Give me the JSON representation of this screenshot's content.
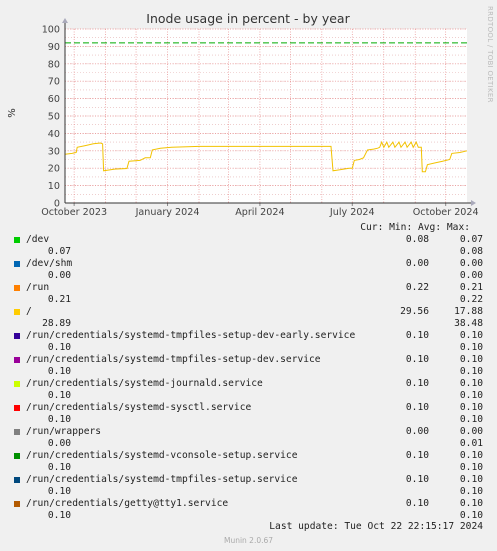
{
  "chart_data": {
    "type": "line",
    "title": "Inode usage in percent - by year",
    "ylabel": "%",
    "ylim": [
      0,
      100
    ],
    "yticks": [
      0,
      10,
      20,
      30,
      40,
      50,
      60,
      70,
      80,
      90,
      100
    ],
    "xticks": [
      "October 2023",
      "January 2024",
      "April 2024",
      "July 2024",
      "October 2024"
    ],
    "xrange": [
      "2023-09-22",
      "2024-10-22"
    ],
    "grid": true,
    "warning_level": 92,
    "series": [
      {
        "name": "/",
        "color": "#f2c200",
        "points": [
          [
            "2023-09-22",
            28
          ],
          [
            "2023-09-29",
            28.5
          ],
          [
            "2023-10-03",
            29
          ],
          [
            "2023-10-04",
            32
          ],
          [
            "2023-10-12",
            33
          ],
          [
            "2023-10-20",
            34
          ],
          [
            "2023-10-27",
            34.5
          ],
          [
            "2023-10-29",
            34
          ],
          [
            "2023-10-30",
            18.5
          ],
          [
            "2023-11-10",
            19.5
          ],
          [
            "2023-11-22",
            19.8
          ],
          [
            "2023-11-24",
            24
          ],
          [
            "2023-12-05",
            24.5
          ],
          [
            "2023-12-10",
            26
          ],
          [
            "2023-12-15",
            26
          ],
          [
            "2023-12-17",
            30.5
          ],
          [
            "2023-12-25",
            31.5
          ],
          [
            "2024-01-05",
            32
          ],
          [
            "2024-02-01",
            32.5
          ],
          [
            "2024-04-01",
            32.5
          ],
          [
            "2024-06-10",
            32.5
          ],
          [
            "2024-06-12",
            18.5
          ],
          [
            "2024-06-18",
            19
          ],
          [
            "2024-06-28",
            20
          ],
          [
            "2024-07-01",
            20
          ],
          [
            "2024-07-03",
            24.5
          ],
          [
            "2024-07-08",
            25
          ],
          [
            "2024-07-12",
            26
          ],
          [
            "2024-07-16",
            30.5
          ],
          [
            "2024-07-22",
            31
          ],
          [
            "2024-07-26",
            31.5
          ],
          [
            "2024-07-28",
            32
          ],
          [
            "2024-07-30",
            35
          ],
          [
            "2024-08-01",
            32
          ],
          [
            "2024-08-04",
            35
          ],
          [
            "2024-08-06",
            32
          ],
          [
            "2024-08-10",
            35
          ],
          [
            "2024-08-12",
            32
          ],
          [
            "2024-08-16",
            35
          ],
          [
            "2024-08-18",
            32
          ],
          [
            "2024-08-22",
            35
          ],
          [
            "2024-08-24",
            32
          ],
          [
            "2024-08-28",
            35
          ],
          [
            "2024-08-30",
            32
          ],
          [
            "2024-09-02",
            35
          ],
          [
            "2024-09-04",
            32
          ],
          [
            "2024-09-07",
            32
          ],
          [
            "2024-09-08",
            18
          ],
          [
            "2024-09-11",
            18
          ],
          [
            "2024-09-13",
            22
          ],
          [
            "2024-09-20",
            23
          ],
          [
            "2024-09-28",
            24
          ],
          [
            "2024-10-05",
            25
          ],
          [
            "2024-10-07",
            28.5
          ],
          [
            "2024-10-15",
            29
          ],
          [
            "2024-10-22",
            30
          ]
        ]
      }
    ]
  },
  "legend": {
    "header": "Cur: Min: Avg: Max:",
    "rows": [
      {
        "name": "/dev",
        "color": "#00cc00",
        "cur": "0.08",
        "min": "0.07",
        "avg": "0.07",
        "max": "0.08"
      },
      {
        "name": "/dev/shm",
        "color": "#0066b3",
        "cur": "0.00",
        "min": "0.00",
        "avg": "0.00",
        "max": "0.00"
      },
      {
        "name": "/run",
        "color": "#ff8000",
        "cur": "0.22",
        "min": "0.21",
        "avg": "0.21",
        "max": "0.22"
      },
      {
        "name": "/",
        "color": "#ffcc00",
        "cur": "29.56",
        "min": "17.88",
        "avg": "28.89",
        "max": "38.48"
      },
      {
        "name": "/run/credentials/systemd-tmpfiles-setup-dev-early.service",
        "color": "#330099",
        "cur": "0.10",
        "min": "0.10",
        "avg": "0.10",
        "max": "0.10"
      },
      {
        "name": "/run/credentials/systemd-tmpfiles-setup-dev.service",
        "color": "#990099",
        "cur": "0.10",
        "min": "0.10",
        "avg": "0.10",
        "max": "0.10"
      },
      {
        "name": "/run/credentials/systemd-journald.service",
        "color": "#ccff00",
        "cur": "0.10",
        "min": "0.10",
        "avg": "0.10",
        "max": "0.10"
      },
      {
        "name": "/run/credentials/systemd-sysctl.service",
        "color": "#ff0000",
        "cur": "0.10",
        "min": "0.10",
        "avg": "0.10",
        "max": "0.10"
      },
      {
        "name": "/run/wrappers",
        "color": "#808080",
        "cur": "0.00",
        "min": "0.00",
        "avg": "0.00",
        "max": "0.01"
      },
      {
        "name": "/run/credentials/systemd-vconsole-setup.service",
        "color": "#008f00",
        "cur": "0.10",
        "min": "0.10",
        "avg": "0.10",
        "max": "0.10"
      },
      {
        "name": "/run/credentials/systemd-tmpfiles-setup.service",
        "color": "#00487d",
        "cur": "0.10",
        "min": "0.10",
        "avg": "0.10",
        "max": "0.10"
      },
      {
        "name": "/run/credentials/getty@tty1.service",
        "color": "#b35a00",
        "cur": "0.10",
        "min": "0.10",
        "avg": "0.10",
        "max": "0.10"
      }
    ]
  },
  "footer": {
    "last_update": "Last update: Tue Oct 22 22:15:17 2024",
    "version": "Munin 2.0.67",
    "watermark": "RRDTOOL / TOBI OETIKER"
  }
}
